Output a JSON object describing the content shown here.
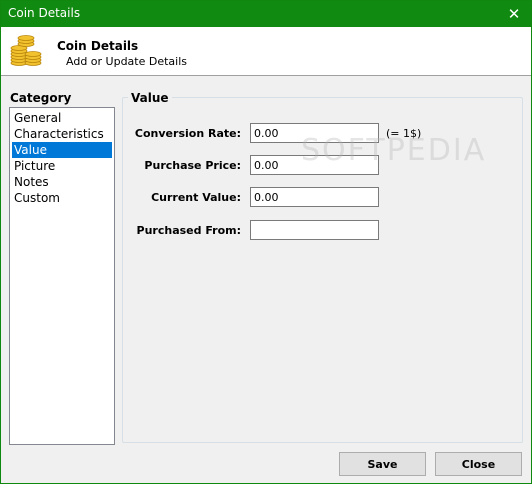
{
  "window": {
    "title": "Coin Details"
  },
  "header": {
    "title": "Coin Details",
    "subtitle": "Add or Update Details"
  },
  "category": {
    "label": "Category",
    "items": [
      "General",
      "Characteristics",
      "Value",
      "Picture",
      "Notes",
      "Custom"
    ],
    "selected": "Value"
  },
  "value_group": {
    "label": "Value",
    "conversion_rate_label": "Conversion Rate:",
    "conversion_rate_value": "0.00",
    "conversion_unit": "(= 1$)",
    "purchase_price_label": "Purchase Price:",
    "purchase_price_value": "0.00",
    "current_value_label": "Current Value:",
    "current_value_value": "0.00",
    "purchased_from_label": "Purchased From:",
    "purchased_from_value": ""
  },
  "watermark": "SOFTPEDIA",
  "buttons": {
    "save": "Save",
    "close": "Close"
  },
  "colors": {
    "titlebar": "#108a10",
    "selection": "#0078d7"
  },
  "icons": {
    "header": "coin-stack-icon",
    "close": "close-icon"
  }
}
